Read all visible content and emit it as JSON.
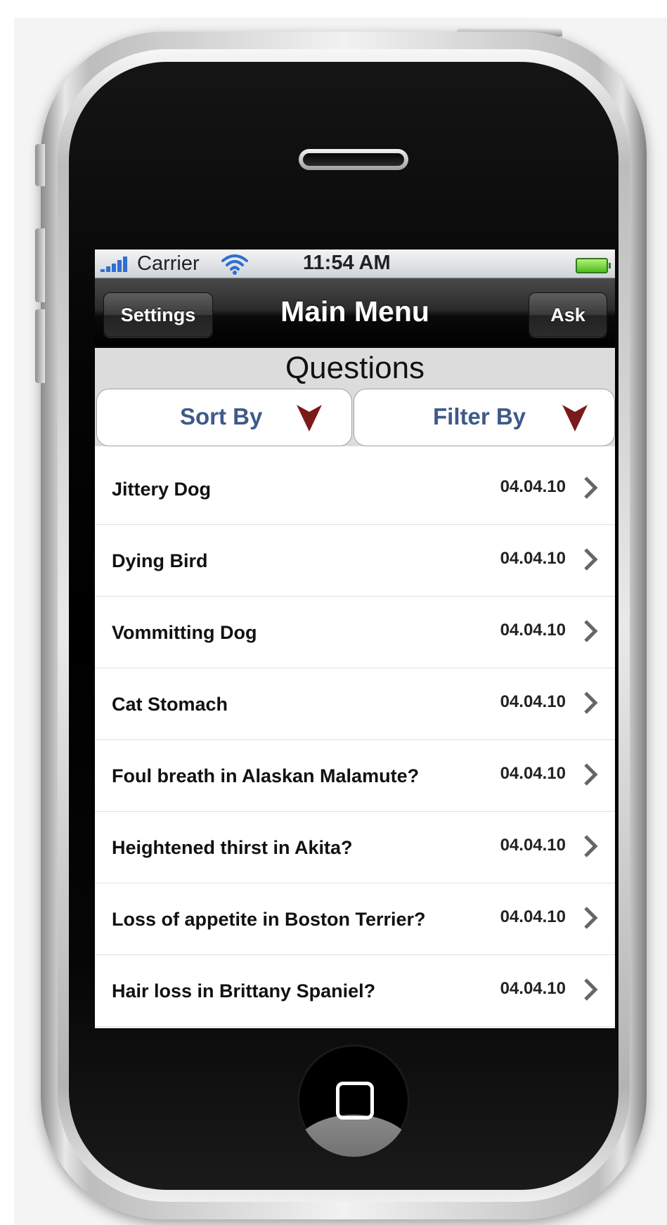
{
  "status_bar": {
    "carrier": "Carrier",
    "time": "11:54 AM",
    "icons": [
      "signal-bars-icon",
      "wifi-icon",
      "battery-icon"
    ]
  },
  "nav": {
    "title": "Main Menu",
    "left_button": "Settings",
    "right_button": "Ask"
  },
  "section": {
    "title": "Questions"
  },
  "filters": {
    "sort_label": "Sort By",
    "filter_label": "Filter By"
  },
  "questions": [
    {
      "title": "Jittery Dog",
      "date": "04.04.10"
    },
    {
      "title": "Dying Bird",
      "date": "04.04.10"
    },
    {
      "title": "Vommitting Dog",
      "date": "04.04.10"
    },
    {
      "title": "Cat Stomach",
      "date": "04.04.10"
    },
    {
      "title": "Foul breath in Alaskan Malamute?",
      "date": "04.04.10"
    },
    {
      "title": "Heightened thirst in Akita?",
      "date": "04.04.10"
    },
    {
      "title": "Loss of appetite in Boston Terrier?",
      "date": "04.04.10"
    },
    {
      "title": "Hair loss in Brittany Spaniel?",
      "date": "04.04.10"
    }
  ],
  "colors": {
    "accent_blue": "#3e5a8a",
    "dropdown_arrow": "#7a1a1a",
    "signal_blue": "#2f6fd1",
    "battery_green": "#4bbf1a"
  }
}
